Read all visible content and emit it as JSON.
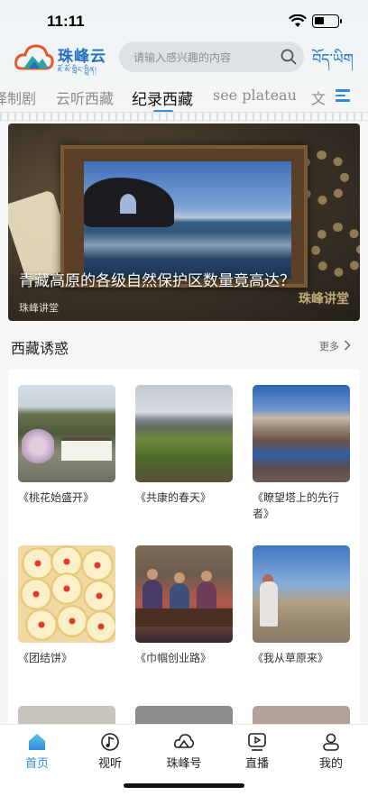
{
  "status_bar": {
    "time": "11:11"
  },
  "header": {
    "logo_name": "珠峰云",
    "logo_subtitle": "ཇོ་མོ་གླིང་སྤྲིན།",
    "search_placeholder": "请输入感兴趣的内容",
    "language_toggle": "བོད་ཡིག"
  },
  "tabs": [
    {
      "label": "译制剧"
    },
    {
      "label": "云听西藏"
    },
    {
      "label": "纪录西藏",
      "active": true
    },
    {
      "label": "see plateau"
    },
    {
      "label": "文"
    }
  ],
  "banner": {
    "title": "青藏高原的各级自然保护区数量竟高达？",
    "source": "珠峰讲堂",
    "watermark": "珠峰讲堂"
  },
  "section": {
    "title": "西藏诱惑",
    "more_label": "更多"
  },
  "items": [
    {
      "caption": "《桃花始盛开》"
    },
    {
      "caption": "《共康的春天》"
    },
    {
      "caption": "《瞭望塔上的先行者》"
    },
    {
      "caption": "《团结饼》"
    },
    {
      "caption": "《巾帼创业路》"
    },
    {
      "caption": "《我从草原来》"
    }
  ],
  "bottom_nav": [
    {
      "label": "首页",
      "icon": "home-icon",
      "active": true
    },
    {
      "label": "视听",
      "icon": "music-note-icon"
    },
    {
      "label": "珠峰号",
      "icon": "cloud-mountain-icon"
    },
    {
      "label": "直播",
      "icon": "play-screen-icon"
    },
    {
      "label": "我的",
      "icon": "user-icon"
    }
  ],
  "colors": {
    "brand_blue": "#1f70c1",
    "active_tab": "#2f8fd8",
    "tab_indicator": "#3a8fc9"
  }
}
